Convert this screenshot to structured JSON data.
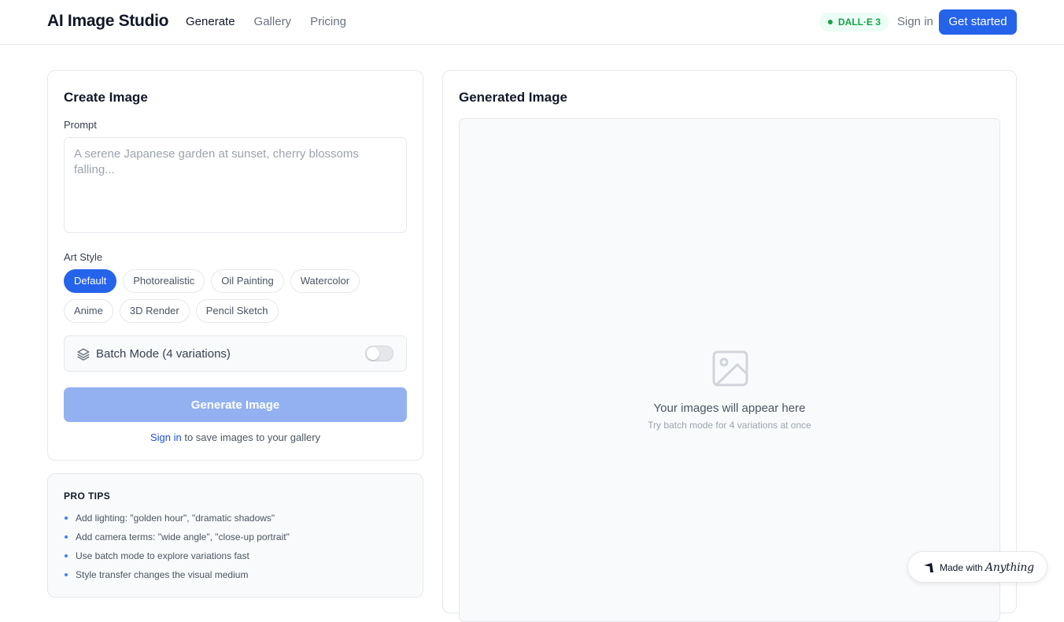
{
  "header": {
    "brand": "AI Image Studio",
    "nav": [
      {
        "label": "Generate",
        "active": true
      },
      {
        "label": "Gallery",
        "active": false
      },
      {
        "label": "Pricing",
        "active": false
      }
    ],
    "model_badge": "DALL·E 3",
    "sign_in": "Sign in",
    "cta": "Get started"
  },
  "create": {
    "title": "Create Image",
    "prompt_label": "Prompt",
    "prompt_value": "",
    "prompt_placeholder": "A serene Japanese garden at sunset, cherry blossoms falling...",
    "style_label": "Art Style",
    "styles_row1": [
      {
        "label": "Default",
        "active": true
      },
      {
        "label": "Photorealistic",
        "active": false
      },
      {
        "label": "Oil Painting",
        "active": false
      },
      {
        "label": "Watercolor",
        "active": false
      }
    ],
    "styles_row2": [
      {
        "label": "Anime",
        "active": false
      },
      {
        "label": "3D Render",
        "active": false
      },
      {
        "label": "Pencil Sketch",
        "active": false
      }
    ],
    "batch_label": "Batch Mode (4 variations)",
    "batch_enabled": false,
    "generate_label": "Generate Image",
    "save_hint_link": "Sign in",
    "save_hint_text": " to save images to your gallery"
  },
  "result": {
    "title": "Generated Image",
    "empty_title": "Your images will appear here",
    "empty_subtitle": "Try batch mode for 4 variations at once"
  },
  "tips": {
    "title": "PRO TIPS",
    "items": [
      "Add lighting: \"golden hour\", \"dramatic shadows\"",
      "Add camera terms: \"wide angle\", \"close-up portrait\"",
      "Use batch mode to explore variations fast",
      "Style transfer changes the visual medium"
    ]
  },
  "made_with": {
    "prefix": "Made with ",
    "brand": "Anything"
  },
  "colors": {
    "accent": "#2563eb",
    "badge_green": "#16a34a",
    "disabled_button": "#93b1f0"
  }
}
